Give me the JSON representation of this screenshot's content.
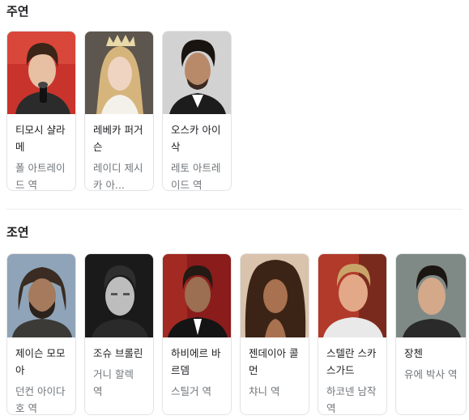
{
  "sections": {
    "main_cast": {
      "title": "주연",
      "cards": [
        {
          "name": "티모시 샬라메",
          "role": "폴 아트레이드 역",
          "photo_icon": "actor-photo"
        },
        {
          "name": "레베카 퍼거슨",
          "role": "레이디 제시카 아...",
          "photo_icon": "actor-photo"
        },
        {
          "name": "오스카 아이삭",
          "role": "레토 아트레이드 역",
          "photo_icon": "actor-photo"
        }
      ]
    },
    "supporting_cast": {
      "title": "조연",
      "cards": [
        {
          "name": "제이슨 모모아",
          "role": "던컨 아이다호 역",
          "photo_icon": "actor-photo"
        },
        {
          "name": "조슈 브롤린",
          "role": "거니 할렉 역",
          "photo_icon": "actor-photo"
        },
        {
          "name": "하비에르 바르뎀",
          "role": "스틸거 역",
          "photo_icon": "actor-photo"
        },
        {
          "name": "젠데이아 콜먼",
          "role": "챠니 역",
          "photo_icon": "actor-photo"
        },
        {
          "name": "스텔란 스카스가드",
          "role": "하코넨 남작 역",
          "photo_icon": "actor-photo"
        },
        {
          "name": "장첸",
          "role": "유에 박사 역",
          "photo_icon": "actor-photo"
        }
      ]
    }
  },
  "colors": {
    "title_text": "#202124",
    "name_text": "#202124",
    "role_text": "#70757a",
    "card_border": "#e3e3e3"
  }
}
